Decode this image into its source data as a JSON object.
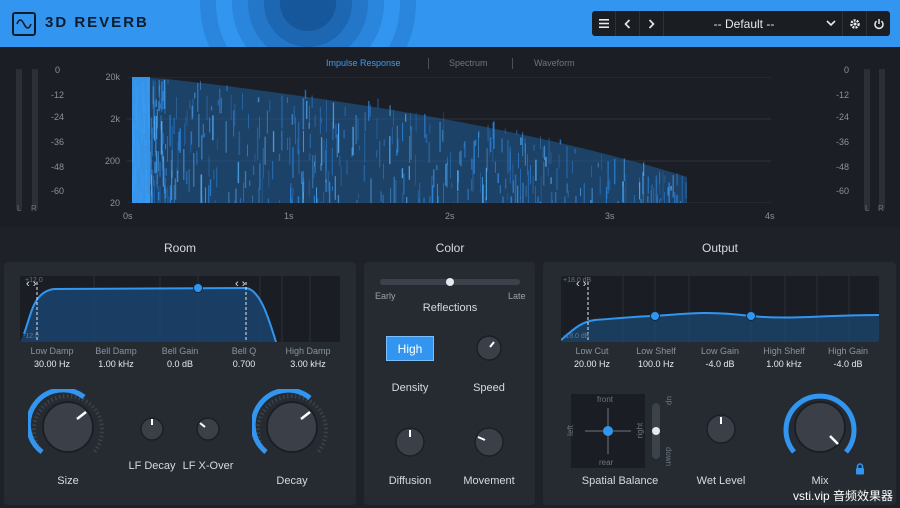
{
  "app": {
    "title": "3D REVERB"
  },
  "preset": {
    "name": "-- Default --"
  },
  "icons": {
    "logo": "waveform-logo-icon",
    "menu": "hamburger-menu-icon",
    "prev": "chevron-left-icon",
    "next": "chevron-right-icon",
    "dropdown": "chevron-down-icon",
    "settings": "gear-icon",
    "power": "power-icon",
    "lock": "lock-icon"
  },
  "colors": {
    "accent": "#3296f0",
    "background": "#1e2228",
    "panel": "#262b32"
  },
  "display": {
    "tabs": [
      "Impulse Response",
      "Spectrum",
      "Waveform"
    ],
    "active_tab": "Impulse Response",
    "db_scale": [
      "0",
      "-12",
      "-24",
      "-36",
      "-48",
      "-60"
    ],
    "meter_labels": [
      "L",
      "R"
    ],
    "freq_labels": [
      "20k",
      "2k",
      "200",
      "20"
    ],
    "time_labels": [
      "0s",
      "1s",
      "2s",
      "3s",
      "4s"
    ]
  },
  "sections": {
    "room": "Room",
    "color": "Color",
    "output": "Output"
  },
  "room": {
    "params": [
      {
        "label": "Low Damp",
        "value": "30.00 Hz"
      },
      {
        "label": "Bell Damp",
        "value": "1.00 kHz"
      },
      {
        "label": "Bell Gain",
        "value": "0.0 dB"
      },
      {
        "label": "Bell Q",
        "value": "0.700"
      },
      {
        "label": "High Damp",
        "value": "3.00 kHz"
      }
    ],
    "eq_scale": [
      "+12.0",
      "-12.0"
    ],
    "knobs": {
      "size": "Size",
      "lf_decay": "LF Decay",
      "lf_xover": "LF X-Over",
      "decay": "Decay"
    }
  },
  "color": {
    "early": "Early",
    "late": "Late",
    "reflections": "Reflections",
    "reflections_value": 0.5,
    "high_button": "High",
    "knobs": {
      "density": "Density",
      "speed": "Speed",
      "diffusion": "Diffusion",
      "movement": "Movement"
    }
  },
  "output": {
    "params": [
      {
        "label": "Low Cut",
        "value": "20.00 Hz"
      },
      {
        "label": "Low Shelf",
        "value": "100.0 Hz"
      },
      {
        "label": "Low Gain",
        "value": "-4.0 dB"
      },
      {
        "label": "High Shelf",
        "value": "1.00 kHz"
      },
      {
        "label": "High Gain",
        "value": "-4.0 dB"
      }
    ],
    "eq_scale": [
      "+18.0 dB",
      "-18.0 dB"
    ],
    "spatial": {
      "front": "front",
      "rear": "rear",
      "left": "left",
      "right": "right",
      "up": "up",
      "down": "down"
    },
    "knobs": {
      "spatial": "Spatial Balance",
      "wet": "Wet Level",
      "mix": "Mix"
    }
  },
  "watermark": "vsti.vip 音频效果器"
}
